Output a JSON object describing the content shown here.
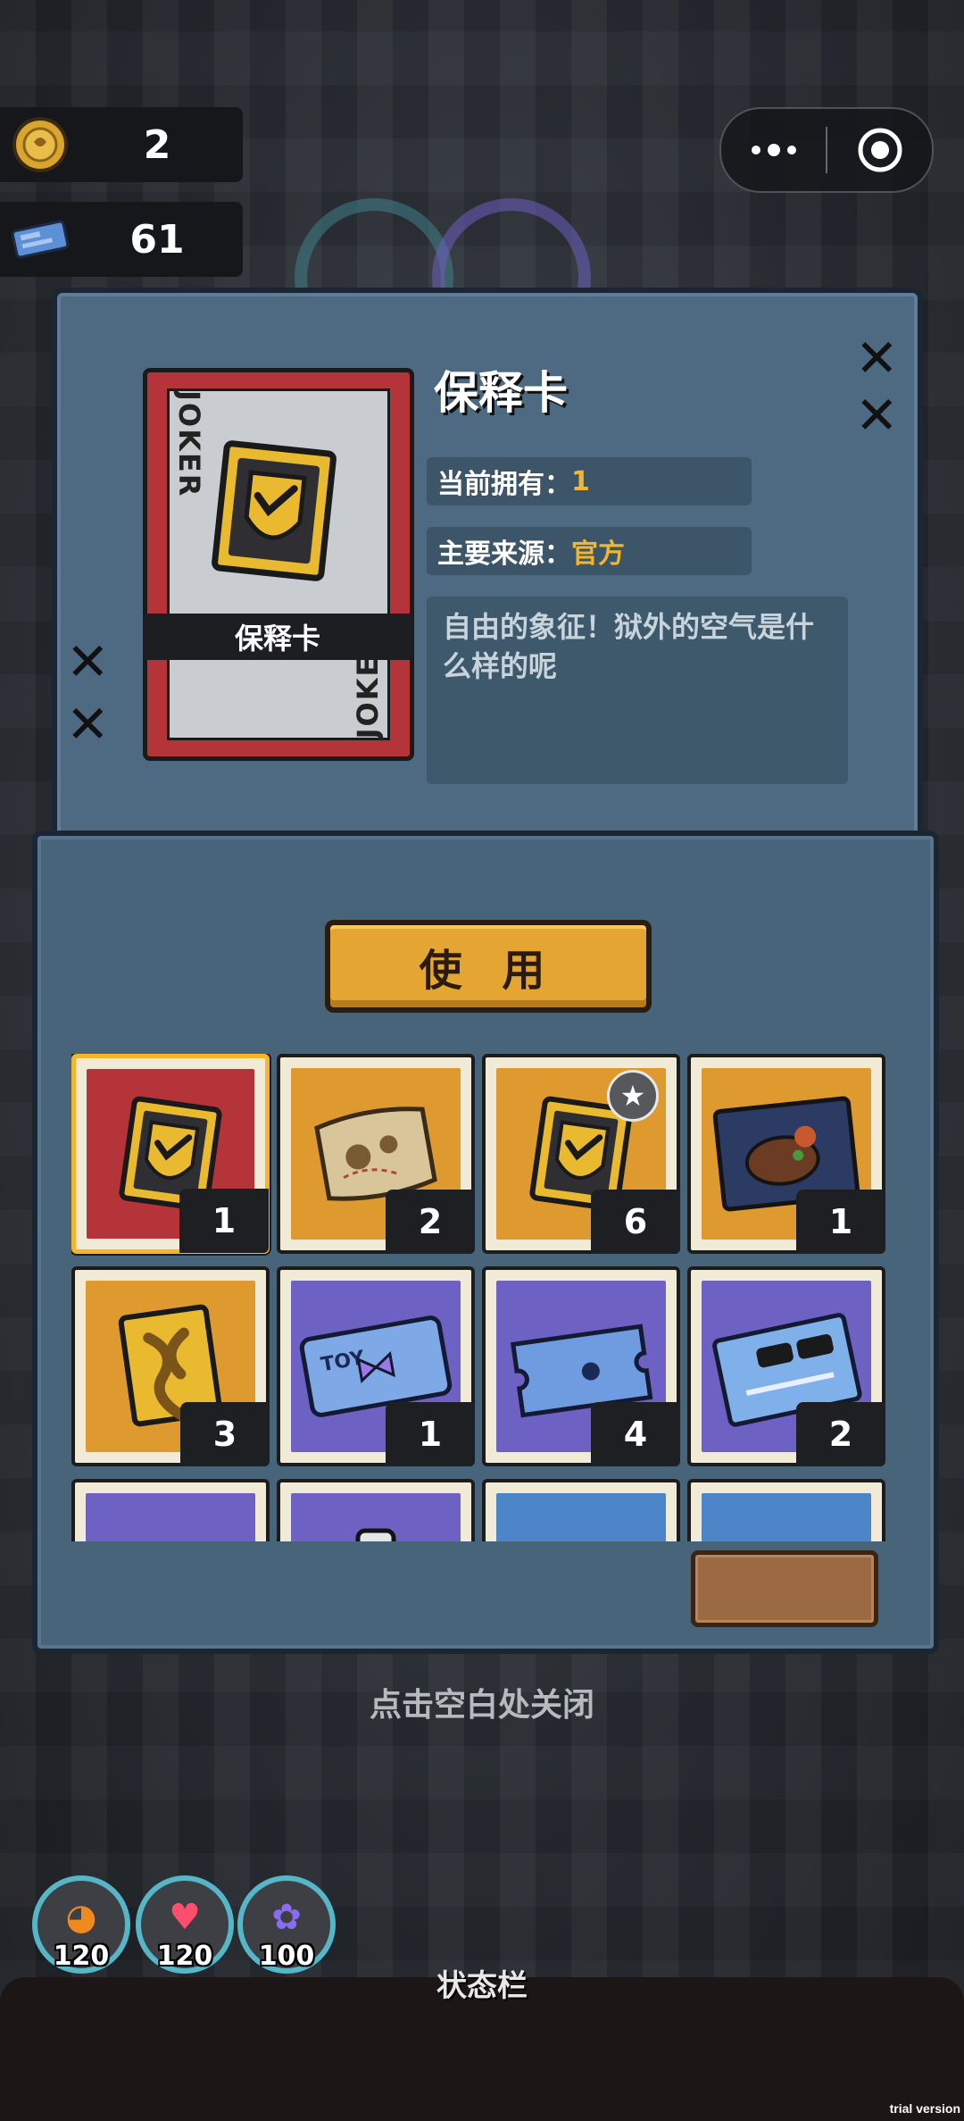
{
  "currencies": {
    "coins": "2",
    "tickets": "61"
  },
  "item": {
    "name": "保释卡",
    "card_name": "保释卡",
    "card_back_text": "JOKER",
    "owned_label": "当前拥有：",
    "owned_value": "1",
    "source_label": "主要来源：",
    "source_value": "官方",
    "description": "自由的象征！狱外的空气是什么样的呢"
  },
  "use_button": "使 用",
  "inventory": [
    {
      "icon": "bail-card-icon",
      "bg": "#b5343a",
      "count": "1",
      "selected": true
    },
    {
      "icon": "treasure-map-icon",
      "bg": "#de9a2e",
      "count": "2"
    },
    {
      "icon": "bail-card-star-icon",
      "bg": "#de9a2e",
      "count": "6",
      "star": true
    },
    {
      "icon": "steak-food-icon",
      "bg": "#de9a2e",
      "count": "1"
    },
    {
      "icon": "ribbon-card-icon",
      "bg": "#de9a2e",
      "count": "3"
    },
    {
      "icon": "toy-ticket-icon",
      "bg": "#6d62c4",
      "count": "1"
    },
    {
      "icon": "puzzle-ticket-icon",
      "bg": "#6d62c4",
      "count": "4"
    },
    {
      "icon": "sunglasses-book-icon",
      "bg": "#6d62c4",
      "count": "2"
    },
    {
      "icon": "red-item-icon",
      "bg": "#6d62c4",
      "count": ""
    },
    {
      "icon": "bottle-item-icon",
      "bg": "#6d62c4",
      "count": ""
    },
    {
      "icon": "gray-item-icon",
      "bg": "#4d85c9",
      "count": ""
    },
    {
      "icon": "red-item-icon",
      "bg": "#4d85c9",
      "count": ""
    }
  ],
  "close_hint": "点击空白处关闭",
  "stats": [
    {
      "icon": "hunger-icon",
      "value": "120",
      "color": "#f08a1f"
    },
    {
      "icon": "heart-icon",
      "value": "120",
      "color": "#ff4d6d"
    },
    {
      "icon": "brain-icon",
      "value": "100",
      "color": "#8a6cf0"
    }
  ],
  "status_bar_label": "状态栏",
  "trial_label": "trial version"
}
